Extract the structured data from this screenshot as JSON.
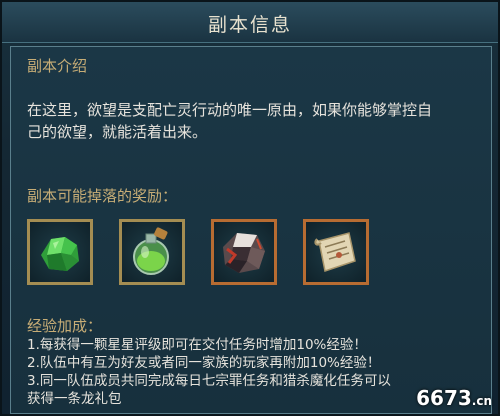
{
  "header": {
    "title": "副本信息"
  },
  "intro": {
    "heading": "副本介绍",
    "text_line1": "在这里，欲望是支配亡灵行动的唯一原由，如果你能够掌控自",
    "text_line2": "己的欲望，就能活着出来。"
  },
  "rewards": {
    "heading": "副本可能掉落的奖励：",
    "items": [
      {
        "icon": "green-crystal-icon",
        "frame": "#a48d52"
      },
      {
        "icon": "green-potion-icon",
        "frame": "#a48d52"
      },
      {
        "icon": "dark-ore-icon",
        "frame": "#b76c32"
      },
      {
        "icon": "scroll-map-icon",
        "frame": "#b76c32"
      }
    ]
  },
  "exp": {
    "heading": "经验加成：",
    "lines": [
      "1.每获得一颗星星评级即可在交付任务时增加10%经验！",
      "2.队伍中有互为好友或者同一家族的玩家再附加10%经验！",
      "3.同一队伍成员共同完成每日七宗罪任务和猎杀魔化任务可以",
      "获得一条龙礼包"
    ]
  },
  "watermark": {
    "text": "6673",
    "suffix": ".cn"
  },
  "colors": {
    "section_title": "#c7ad76",
    "body_text": "#e6e3dc",
    "header_text": "#e8e2cf"
  }
}
